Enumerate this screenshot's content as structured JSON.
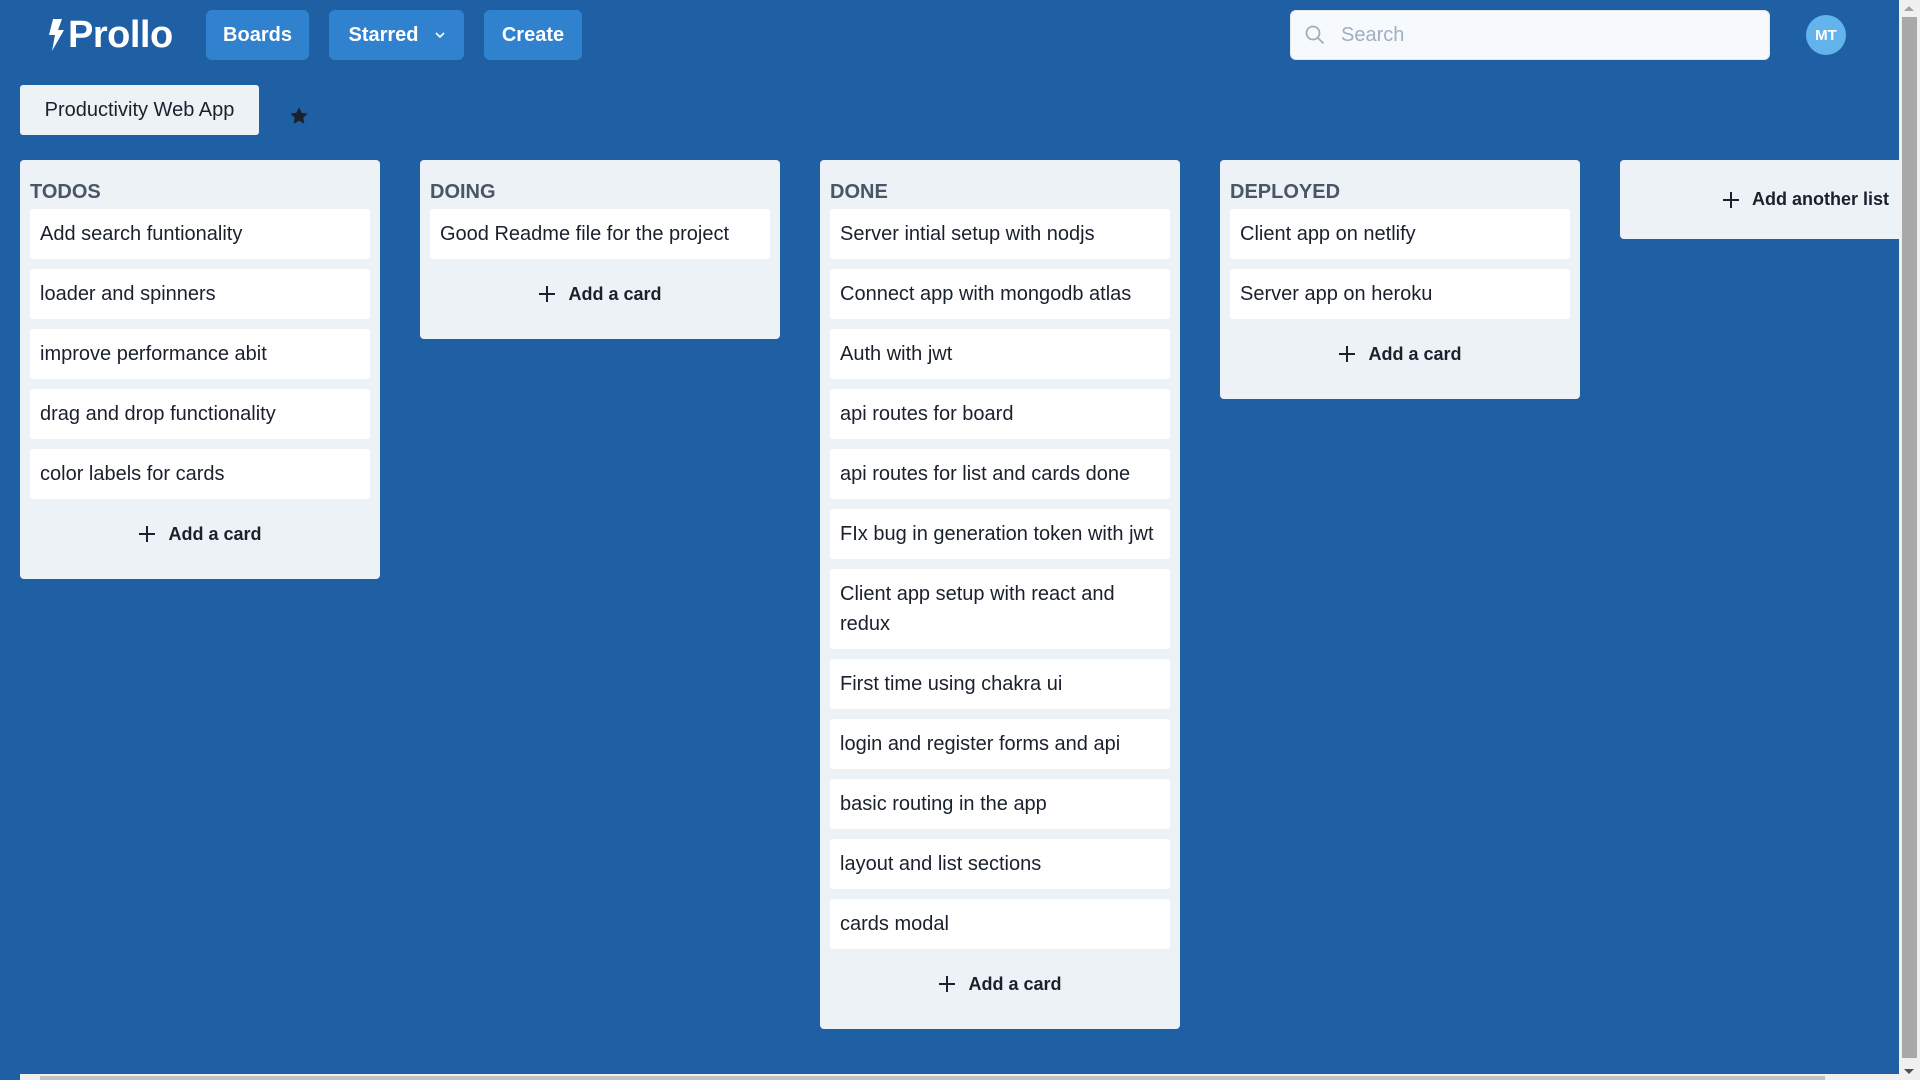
{
  "header": {
    "logo_text": "Prollo",
    "logo_icon": "lightning-bolt-icon",
    "nav": {
      "boards_label": "Boards",
      "starred_label": "Starred",
      "create_label": "Create"
    },
    "search": {
      "placeholder": "Search",
      "value": ""
    },
    "avatar_initials": "MT"
  },
  "board": {
    "title": "Productivity Web App",
    "starred": true
  },
  "lists": [
    {
      "title": "TODOS",
      "cards": [
        "Add search funtionality",
        "loader and spinners",
        "improve performance abit",
        "drag and drop functionality",
        "color labels for cards"
      ],
      "add_card_label": "Add a card"
    },
    {
      "title": "DOING",
      "cards": [
        "Good Readme file for the project"
      ],
      "add_card_label": "Add a card"
    },
    {
      "title": "DONE",
      "cards": [
        "Server intial setup with nodjs",
        "Connect app with mongodb atlas",
        "Auth with jwt",
        "api routes for board",
        "api routes for list and cards done",
        "FIx bug in generation token with jwt",
        "Client app setup with react and redux",
        "First time using chakra ui",
        "login and register forms and api",
        "basic routing in the app",
        "layout and list sections",
        "cards modal"
      ],
      "add_card_label": "Add a card"
    },
    {
      "title": "DEPLOYED",
      "cards": [
        "Client app on netlify",
        "Server app on heroku"
      ],
      "add_card_label": "Add a card"
    }
  ],
  "add_list_label": "Add another list",
  "colors": {
    "background": "#1f5fa3",
    "button": "#3182ce",
    "list_bg": "#edf2f7",
    "avatar": "#63b3ed",
    "list_title": "#4a5568"
  }
}
